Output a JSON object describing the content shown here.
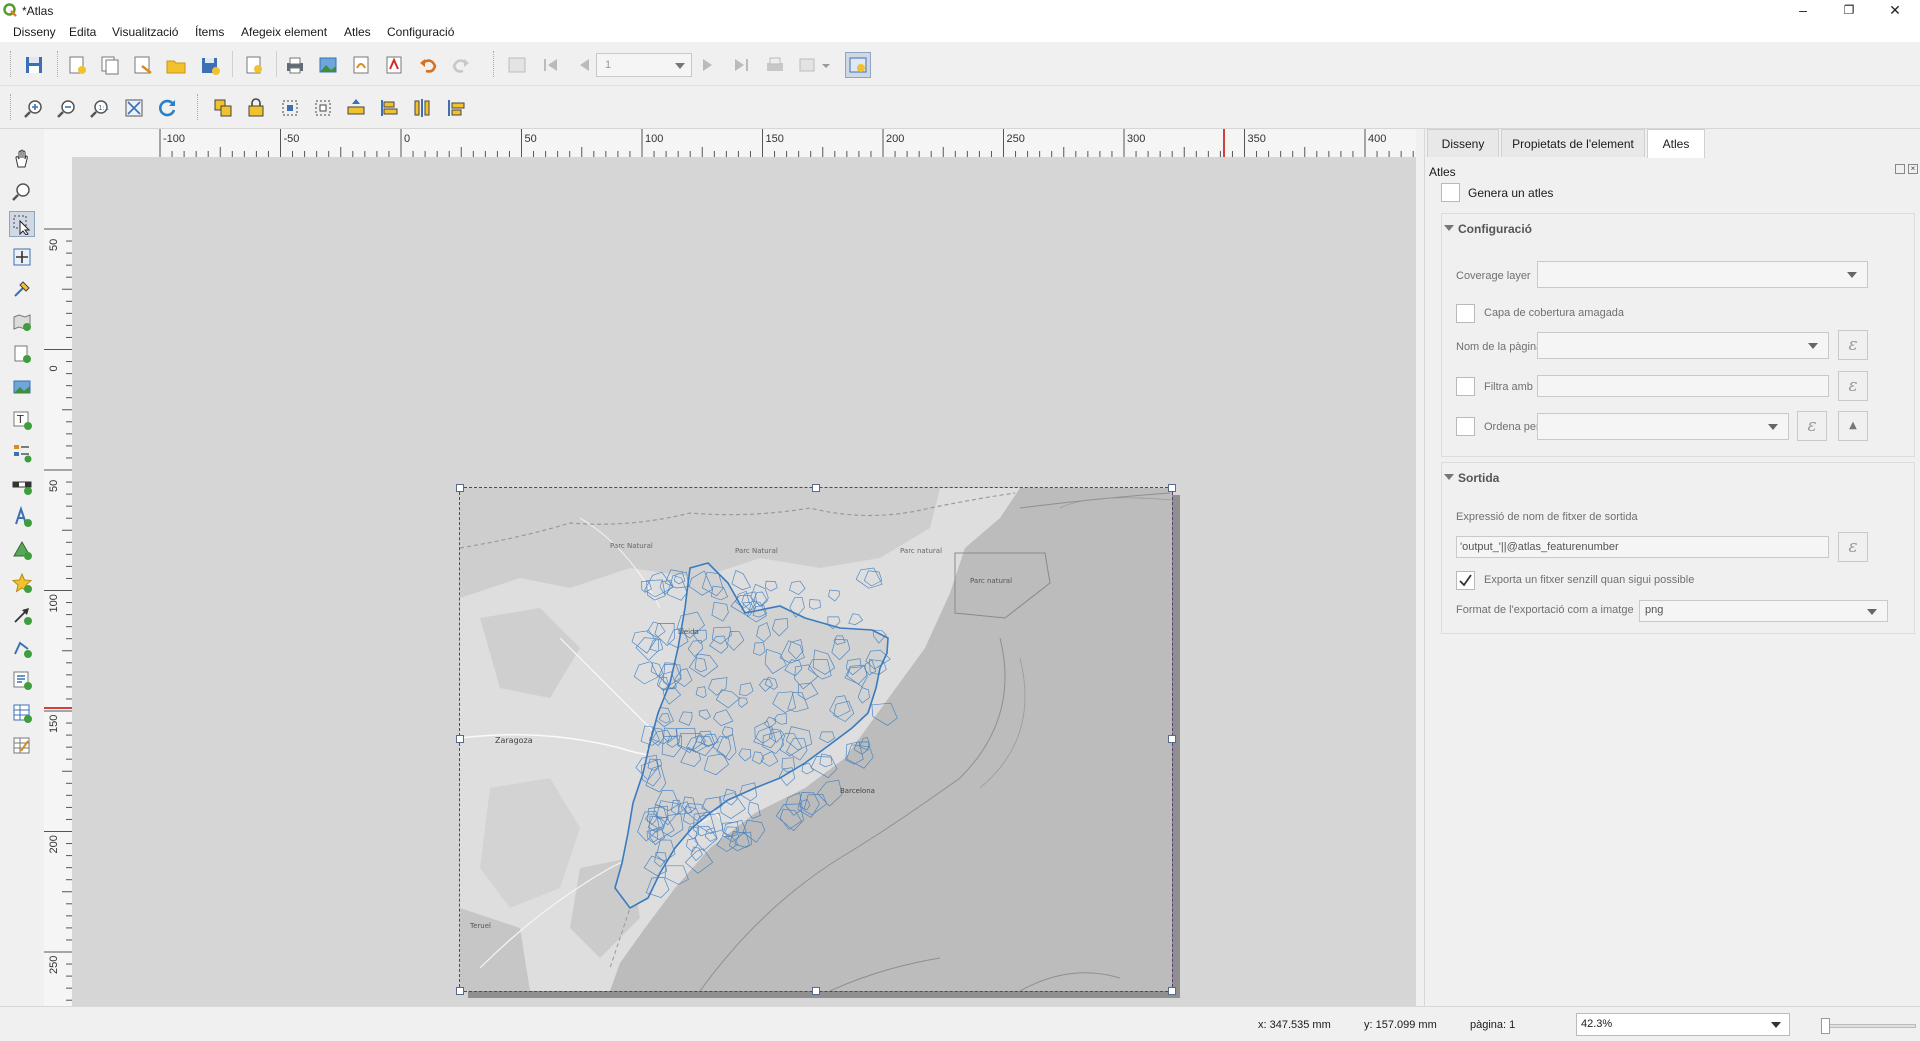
{
  "window": {
    "title": "*Atlas",
    "minimize": "–",
    "restore": "❐",
    "close": "✕"
  },
  "menu": [
    {
      "label": "Disseny"
    },
    {
      "label": "Edita"
    },
    {
      "label": "Visualització"
    },
    {
      "label": "Ítems"
    },
    {
      "label": "Afegeix element"
    },
    {
      "label": "Atles"
    },
    {
      "label": "Configuració"
    }
  ],
  "atlas_toolbar": {
    "page_value": "1"
  },
  "ruler": {
    "h_labels": [
      "-100",
      "-50",
      "0",
      "50",
      "100",
      "150",
      "200",
      "250",
      "300",
      "350",
      "400"
    ],
    "v_labels": [
      "50",
      "0",
      "50",
      "100",
      "150",
      "200",
      "250"
    ]
  },
  "map": {
    "labels": [
      "Parc Natural",
      "Parc Natural",
      "Parc natural",
      "Parc natural",
      "Lleida",
      "Zaragoza",
      "Barcelona",
      "Teruel"
    ]
  },
  "panel": {
    "tabs": [
      {
        "label": "Disseny"
      },
      {
        "label": "Propietats de l'element"
      },
      {
        "label": "Atles"
      }
    ],
    "active_tab": "Atles",
    "title": "Atles",
    "generate_atlas": {
      "label": "Genera un atles",
      "checked": false
    },
    "config": {
      "title": "Configuració",
      "coverage_layer_label": "Coverage layer",
      "coverage_layer_value": "",
      "hidden_coverage_label": "Capa de cobertura amagada",
      "page_name_label": "Nom de la pàgina",
      "filter_label": "Filtra amb",
      "sort_label": "Ordena per"
    },
    "output": {
      "title": "Sortida",
      "filename_expr_label": "Expressió de nom de fitxer de sortida",
      "filename_expr_value": "'output_'||@atlas_featurenumber",
      "single_file_label": "Exporta un fitxer senzill quan sigui possible",
      "single_file_checked": true,
      "image_format_label": "Format de l'exportació com a imatge",
      "image_format_value": "png"
    },
    "expr_glyph": "ε",
    "up_glyph": "▲"
  },
  "status": {
    "x": "x: 347.535 mm",
    "y": "y: 157.099 mm",
    "page": "pàgina: 1",
    "zoom": "42.3%"
  },
  "colors": {
    "accent": "#3a6ea5",
    "boundary": "#3a7bbf",
    "canvas": "#d6d6d6"
  }
}
